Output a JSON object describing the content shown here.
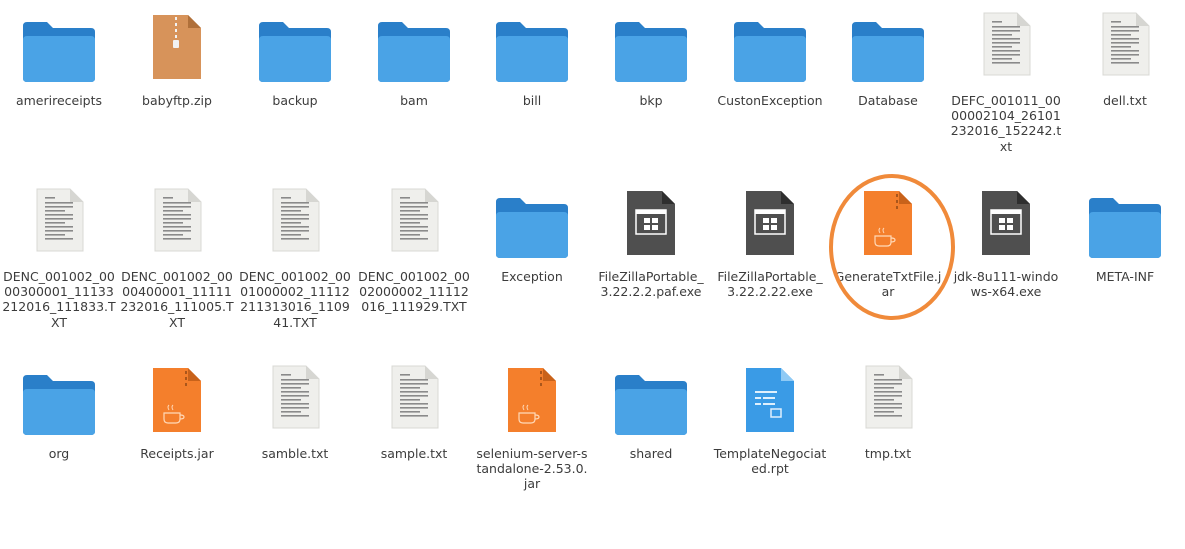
{
  "colors": {
    "folder_back": "#2a7fc9",
    "folder_front": "#4aa3e6",
    "doc_paper": "#efefec",
    "doc_lines": "#8a8a8a",
    "exe_body": "#4f4f4f",
    "jar_body": "#f47f2c",
    "zip_body": "#d7935a",
    "rpt_body": "#3a9be6",
    "highlight": "#f08a3a"
  },
  "files": [
    {
      "name": "amerireceipts",
      "icon": "folder-icon"
    },
    {
      "name": "babyftp.zip",
      "icon": "zip-archive-icon"
    },
    {
      "name": "backup",
      "icon": "folder-icon"
    },
    {
      "name": "bam",
      "icon": "folder-icon"
    },
    {
      "name": "bill",
      "icon": "folder-icon"
    },
    {
      "name": "bkp",
      "icon": "folder-icon"
    },
    {
      "name": "CustonException",
      "icon": "folder-icon"
    },
    {
      "name": "Database",
      "icon": "folder-icon"
    },
    {
      "name": "DEFC_001011_0000002104_26101232016_152242.txt",
      "icon": "text-document-icon"
    },
    {
      "name": "dell.txt",
      "icon": "text-document-icon"
    },
    {
      "name": "DENC_001002_0000300001_11133212016_111833.TXT",
      "icon": "text-document-icon"
    },
    {
      "name": "DENC_001002_0000400001_11111232016_111005.TXT",
      "icon": "text-document-icon"
    },
    {
      "name": "DENC_001002_0001000002_11112211313016_110941.TXT",
      "icon": "text-document-icon"
    },
    {
      "name": "DENC_001002_0002000002_11112016_111929.TXT",
      "icon": "text-document-icon"
    },
    {
      "name": "Exception",
      "icon": "folder-icon"
    },
    {
      "name": "FileZillaPortable_3.22.2.2.paf.exe",
      "icon": "executable-icon"
    },
    {
      "name": "FileZillaPortable_3.22.2.22.exe",
      "icon": "executable-icon"
    },
    {
      "name": "GenerateTxtFile.jar",
      "icon": "java-archive-icon",
      "highlighted": true
    },
    {
      "name": "jdk-8u111-windows-x64.exe",
      "icon": "executable-icon"
    },
    {
      "name": "META-INF",
      "icon": "folder-icon"
    },
    {
      "name": "org",
      "icon": "folder-icon"
    },
    {
      "name": "Receipts.jar",
      "icon": "java-archive-icon"
    },
    {
      "name": "samble.txt",
      "icon": "text-document-icon"
    },
    {
      "name": "sample.txt",
      "icon": "text-document-icon"
    },
    {
      "name": "selenium-server-standalone-2.53.0.jar",
      "icon": "java-archive-icon"
    },
    {
      "name": "shared",
      "icon": "folder-icon"
    },
    {
      "name": "TemplateNegociated.rpt",
      "icon": "report-document-icon"
    },
    {
      "name": "tmp.txt",
      "icon": "text-document-icon"
    }
  ]
}
